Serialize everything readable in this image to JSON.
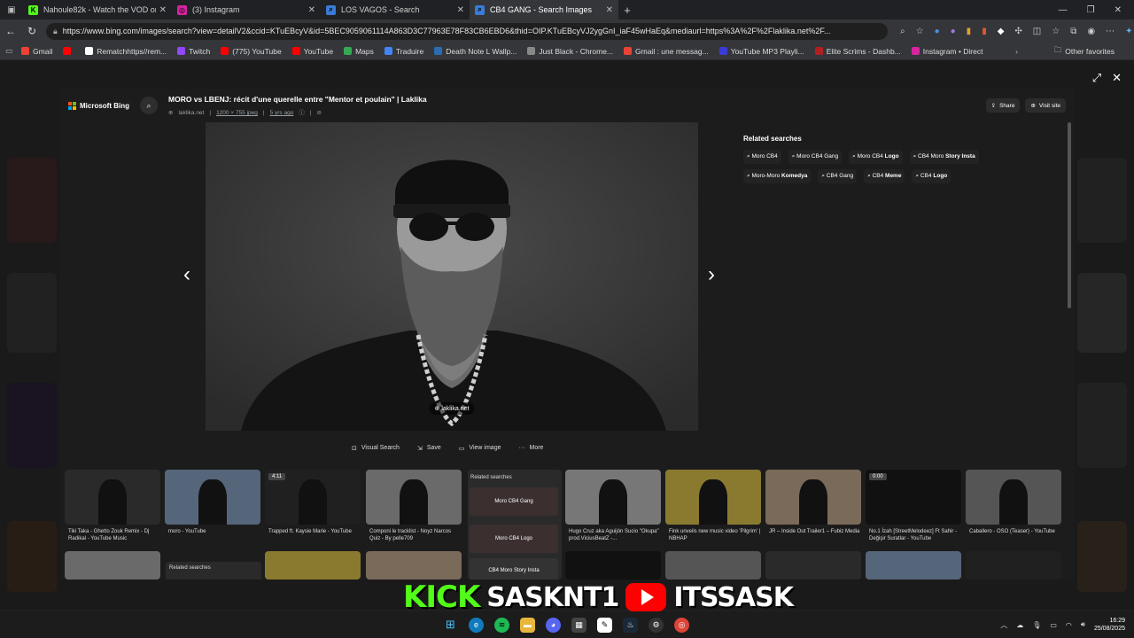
{
  "tabs": [
    {
      "title": "Nahoule82k - Watch the VOD on",
      "icon": "kick-icon",
      "color": "#53fc18",
      "glyph": "K"
    },
    {
      "title": "(3) Instagram",
      "icon": "instagram-icon",
      "color": "#d6249f",
      "glyph": "◎"
    },
    {
      "title": "LOS VAGOS - Search",
      "icon": "search-icon",
      "color": "#3a7bd5",
      "glyph": "⌕"
    },
    {
      "title": "CB4 GANG - Search Images",
      "icon": "search-icon",
      "color": "#3a7bd5",
      "glyph": "⌕",
      "active": true
    }
  ],
  "address": {
    "url": "https://www.bing.com/images/search?view=detailV2&ccid=KTuEBcyV&id=5BEC9059061114A863D3C77963E78F83CB6EBD6&thid=OIP.KTuEBcyVJ2ygGnI_iaF45wHaEq&mediaurl=https%3A%2F%2Flaklika.net%2F..."
  },
  "bookmarks": [
    {
      "label": "Gmail",
      "color": "#ea4335"
    },
    {
      "label": "",
      "color": "#ff0000"
    },
    {
      "label": "Rematchhttps//rem...",
      "color": "#ffffff"
    },
    {
      "label": "Twitch",
      "color": "#9146ff"
    },
    {
      "label": "(775) YouTube",
      "color": "#ff0000"
    },
    {
      "label": "YouTube",
      "color": "#ff0000"
    },
    {
      "label": "Maps",
      "color": "#34a853"
    },
    {
      "label": "Traduire",
      "color": "#4285f4"
    },
    {
      "label": "Death Note L Wallp...",
      "color": "#2b6cb0"
    },
    {
      "label": "Just Black - Chrome...",
      "color": "#888888"
    },
    {
      "label": "Gmail : une messag...",
      "color": "#ea4335"
    },
    {
      "label": "YouTube MP3 Playli...",
      "color": "#3b3bd6"
    },
    {
      "label": "Elite Scrims - Dashb...",
      "color": "#b02020"
    },
    {
      "label": "Instagram • Direct",
      "color": "#d6249f"
    }
  ],
  "other_favorites": "Other favorites",
  "modal": {
    "brand": "Microsoft Bing",
    "title": "MORO vs LBENJ: récit d'une querelle entre \"Mentor et poulain\" | Laklika",
    "site": "laklika.net",
    "dims": "1200 × 755 jpeg",
    "age": "5 yrs ago",
    "share": "Share",
    "visit": "Visit site",
    "image_source": "laklika.net",
    "related_heading": "Related searches",
    "related": [
      {
        "pre": "Moro CB4",
        "bold": ""
      },
      {
        "pre": "Moro CB4 Gang",
        "bold": ""
      },
      {
        "pre": "Moro CB4 ",
        "bold": "Logo"
      },
      {
        "pre": "CB4 Moro ",
        "bold": "Story Insta"
      },
      {
        "pre": "Moro-Moro ",
        "bold": "Komedya"
      },
      {
        "pre": "CB4 Gang",
        "bold": ""
      },
      {
        "pre": "CB4 ",
        "bold": "Meme"
      },
      {
        "pre": "CB4 ",
        "bold": "Logo"
      }
    ],
    "actions": [
      {
        "label": "Visual Search",
        "icon": "visual-search-icon",
        "glyph": "⊡"
      },
      {
        "label": "Save",
        "icon": "save-icon",
        "glyph": "⇲"
      },
      {
        "label": "View image",
        "icon": "view-image-icon",
        "glyph": "▭"
      },
      {
        "label": "More",
        "icon": "more-icon",
        "glyph": "···"
      }
    ]
  },
  "thumbs_row1": [
    {
      "caption": "Tiki Taka - Ghetto Zouk Remix - Dj Radikal - YouTube Music",
      "badge": ""
    },
    {
      "caption": "moro - YouTube",
      "badge": ""
    },
    {
      "caption": "Trapped ft. Kaysie Marie - YouTube",
      "badge": "4:11"
    },
    {
      "caption": "Componi le tracklist - Noyz Narcos Quiz - By pelle709",
      "badge": ""
    },
    {
      "caption": "Hugo Cruz aka Aguijón Sucio \"Okupa\" prod.ViciusBeatZ -...",
      "badge": ""
    },
    {
      "caption": "Fink unveils new music video 'Pilgrim' | NBHAP",
      "badge": ""
    },
    {
      "caption": "JR – Inside Out Trailer1 – Fubiz Media",
      "badge": ""
    },
    {
      "caption": "No.1 İzah [StreetMelodeez] Ft Sahir - Değişir Suratlar - YouTube",
      "badge": "0:00"
    },
    {
      "caption": "Caballero - OSO (Teaser) - YouTube",
      "badge": ""
    }
  ],
  "related_card": {
    "heading": "Related searches",
    "items": [
      "Moro CB4 Gang",
      "Moro CB4 Logo",
      "CB4 Moro Story Insta"
    ]
  },
  "related_card2": {
    "heading": "Related searches"
  },
  "overlay": {
    "kick": "KICK",
    "kick_handle": "SASKNT1",
    "yt_handle": "ITSSASK"
  },
  "clock": {
    "time": "16:29",
    "date": "25/08/2025"
  }
}
